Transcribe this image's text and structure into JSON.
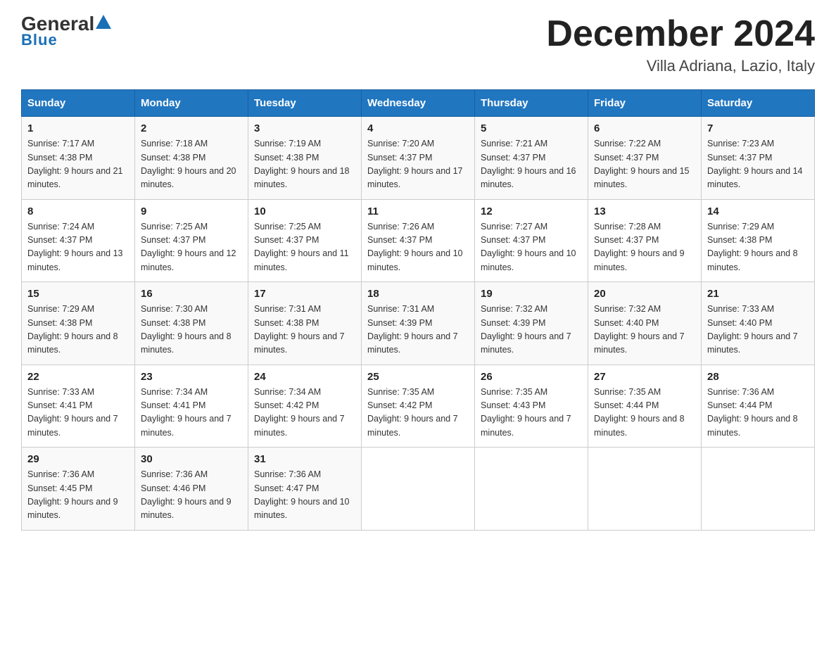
{
  "logo": {
    "general": "General",
    "blue": "Blue",
    "triangle_label": "logo-triangle"
  },
  "header": {
    "month": "December 2024",
    "location": "Villa Adriana, Lazio, Italy"
  },
  "weekdays": [
    "Sunday",
    "Monday",
    "Tuesday",
    "Wednesday",
    "Thursday",
    "Friday",
    "Saturday"
  ],
  "weeks": [
    [
      {
        "day": "1",
        "sunrise": "Sunrise: 7:17 AM",
        "sunset": "Sunset: 4:38 PM",
        "daylight": "Daylight: 9 hours and 21 minutes."
      },
      {
        "day": "2",
        "sunrise": "Sunrise: 7:18 AM",
        "sunset": "Sunset: 4:38 PM",
        "daylight": "Daylight: 9 hours and 20 minutes."
      },
      {
        "day": "3",
        "sunrise": "Sunrise: 7:19 AM",
        "sunset": "Sunset: 4:38 PM",
        "daylight": "Daylight: 9 hours and 18 minutes."
      },
      {
        "day": "4",
        "sunrise": "Sunrise: 7:20 AM",
        "sunset": "Sunset: 4:37 PM",
        "daylight": "Daylight: 9 hours and 17 minutes."
      },
      {
        "day": "5",
        "sunrise": "Sunrise: 7:21 AM",
        "sunset": "Sunset: 4:37 PM",
        "daylight": "Daylight: 9 hours and 16 minutes."
      },
      {
        "day": "6",
        "sunrise": "Sunrise: 7:22 AM",
        "sunset": "Sunset: 4:37 PM",
        "daylight": "Daylight: 9 hours and 15 minutes."
      },
      {
        "day": "7",
        "sunrise": "Sunrise: 7:23 AM",
        "sunset": "Sunset: 4:37 PM",
        "daylight": "Daylight: 9 hours and 14 minutes."
      }
    ],
    [
      {
        "day": "8",
        "sunrise": "Sunrise: 7:24 AM",
        "sunset": "Sunset: 4:37 PM",
        "daylight": "Daylight: 9 hours and 13 minutes."
      },
      {
        "day": "9",
        "sunrise": "Sunrise: 7:25 AM",
        "sunset": "Sunset: 4:37 PM",
        "daylight": "Daylight: 9 hours and 12 minutes."
      },
      {
        "day": "10",
        "sunrise": "Sunrise: 7:25 AM",
        "sunset": "Sunset: 4:37 PM",
        "daylight": "Daylight: 9 hours and 11 minutes."
      },
      {
        "day": "11",
        "sunrise": "Sunrise: 7:26 AM",
        "sunset": "Sunset: 4:37 PM",
        "daylight": "Daylight: 9 hours and 10 minutes."
      },
      {
        "day": "12",
        "sunrise": "Sunrise: 7:27 AM",
        "sunset": "Sunset: 4:37 PM",
        "daylight": "Daylight: 9 hours and 10 minutes."
      },
      {
        "day": "13",
        "sunrise": "Sunrise: 7:28 AM",
        "sunset": "Sunset: 4:37 PM",
        "daylight": "Daylight: 9 hours and 9 minutes."
      },
      {
        "day": "14",
        "sunrise": "Sunrise: 7:29 AM",
        "sunset": "Sunset: 4:38 PM",
        "daylight": "Daylight: 9 hours and 8 minutes."
      }
    ],
    [
      {
        "day": "15",
        "sunrise": "Sunrise: 7:29 AM",
        "sunset": "Sunset: 4:38 PM",
        "daylight": "Daylight: 9 hours and 8 minutes."
      },
      {
        "day": "16",
        "sunrise": "Sunrise: 7:30 AM",
        "sunset": "Sunset: 4:38 PM",
        "daylight": "Daylight: 9 hours and 8 minutes."
      },
      {
        "day": "17",
        "sunrise": "Sunrise: 7:31 AM",
        "sunset": "Sunset: 4:38 PM",
        "daylight": "Daylight: 9 hours and 7 minutes."
      },
      {
        "day": "18",
        "sunrise": "Sunrise: 7:31 AM",
        "sunset": "Sunset: 4:39 PM",
        "daylight": "Daylight: 9 hours and 7 minutes."
      },
      {
        "day": "19",
        "sunrise": "Sunrise: 7:32 AM",
        "sunset": "Sunset: 4:39 PM",
        "daylight": "Daylight: 9 hours and 7 minutes."
      },
      {
        "day": "20",
        "sunrise": "Sunrise: 7:32 AM",
        "sunset": "Sunset: 4:40 PM",
        "daylight": "Daylight: 9 hours and 7 minutes."
      },
      {
        "day": "21",
        "sunrise": "Sunrise: 7:33 AM",
        "sunset": "Sunset: 4:40 PM",
        "daylight": "Daylight: 9 hours and 7 minutes."
      }
    ],
    [
      {
        "day": "22",
        "sunrise": "Sunrise: 7:33 AM",
        "sunset": "Sunset: 4:41 PM",
        "daylight": "Daylight: 9 hours and 7 minutes."
      },
      {
        "day": "23",
        "sunrise": "Sunrise: 7:34 AM",
        "sunset": "Sunset: 4:41 PM",
        "daylight": "Daylight: 9 hours and 7 minutes."
      },
      {
        "day": "24",
        "sunrise": "Sunrise: 7:34 AM",
        "sunset": "Sunset: 4:42 PM",
        "daylight": "Daylight: 9 hours and 7 minutes."
      },
      {
        "day": "25",
        "sunrise": "Sunrise: 7:35 AM",
        "sunset": "Sunset: 4:42 PM",
        "daylight": "Daylight: 9 hours and 7 minutes."
      },
      {
        "day": "26",
        "sunrise": "Sunrise: 7:35 AM",
        "sunset": "Sunset: 4:43 PM",
        "daylight": "Daylight: 9 hours and 7 minutes."
      },
      {
        "day": "27",
        "sunrise": "Sunrise: 7:35 AM",
        "sunset": "Sunset: 4:44 PM",
        "daylight": "Daylight: 9 hours and 8 minutes."
      },
      {
        "day": "28",
        "sunrise": "Sunrise: 7:36 AM",
        "sunset": "Sunset: 4:44 PM",
        "daylight": "Daylight: 9 hours and 8 minutes."
      }
    ],
    [
      {
        "day": "29",
        "sunrise": "Sunrise: 7:36 AM",
        "sunset": "Sunset: 4:45 PM",
        "daylight": "Daylight: 9 hours and 9 minutes."
      },
      {
        "day": "30",
        "sunrise": "Sunrise: 7:36 AM",
        "sunset": "Sunset: 4:46 PM",
        "daylight": "Daylight: 9 hours and 9 minutes."
      },
      {
        "day": "31",
        "sunrise": "Sunrise: 7:36 AM",
        "sunset": "Sunset: 4:47 PM",
        "daylight": "Daylight: 9 hours and 10 minutes."
      },
      null,
      null,
      null,
      null
    ]
  ]
}
